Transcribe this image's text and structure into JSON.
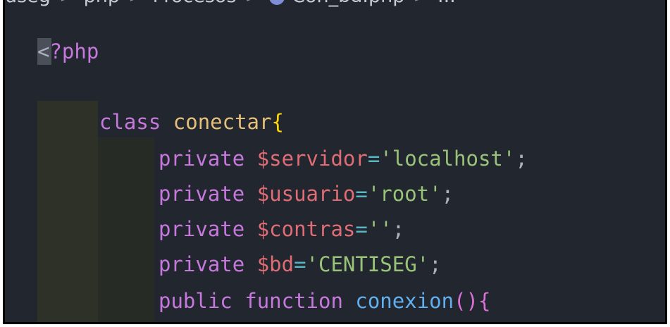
{
  "breadcrumb": {
    "segments": [
      "useg",
      "php",
      "Procesos",
      "Con_bd.php",
      "..."
    ]
  },
  "code": {
    "line1_open": "<",
    "line1_tag": "?php",
    "line3_kw": "class",
    "line3_name": "conectar",
    "line3_brace": "{",
    "line4_kw": "private",
    "line4_var": "$servidor",
    "line4_eq": "=",
    "line4_val": "'localhost'",
    "line4_end": ";",
    "line5_kw": "private",
    "line5_var": "$usuario",
    "line5_eq": "=",
    "line5_val": "'root'",
    "line5_end": ";",
    "line6_kw": "private",
    "line6_var": "$contras",
    "line6_eq": "=",
    "line6_val": "''",
    "line6_end": ";",
    "line7_kw": "private",
    "line7_var": "$bd",
    "line7_eq": "=",
    "line7_val": "'CENTISEG'",
    "line7_end": ";",
    "line8_kw1": "public",
    "line8_kw2": "function",
    "line8_fn": "conexion",
    "line8_parens": "()",
    "line8_brace": "{"
  },
  "colors": {
    "editor_bg": "#22262e",
    "keyword": "#c678dd",
    "class_name": "#e5c07b",
    "variable": "#e06c75",
    "operator": "#56b6c2",
    "string": "#98c379",
    "function": "#61afef"
  }
}
